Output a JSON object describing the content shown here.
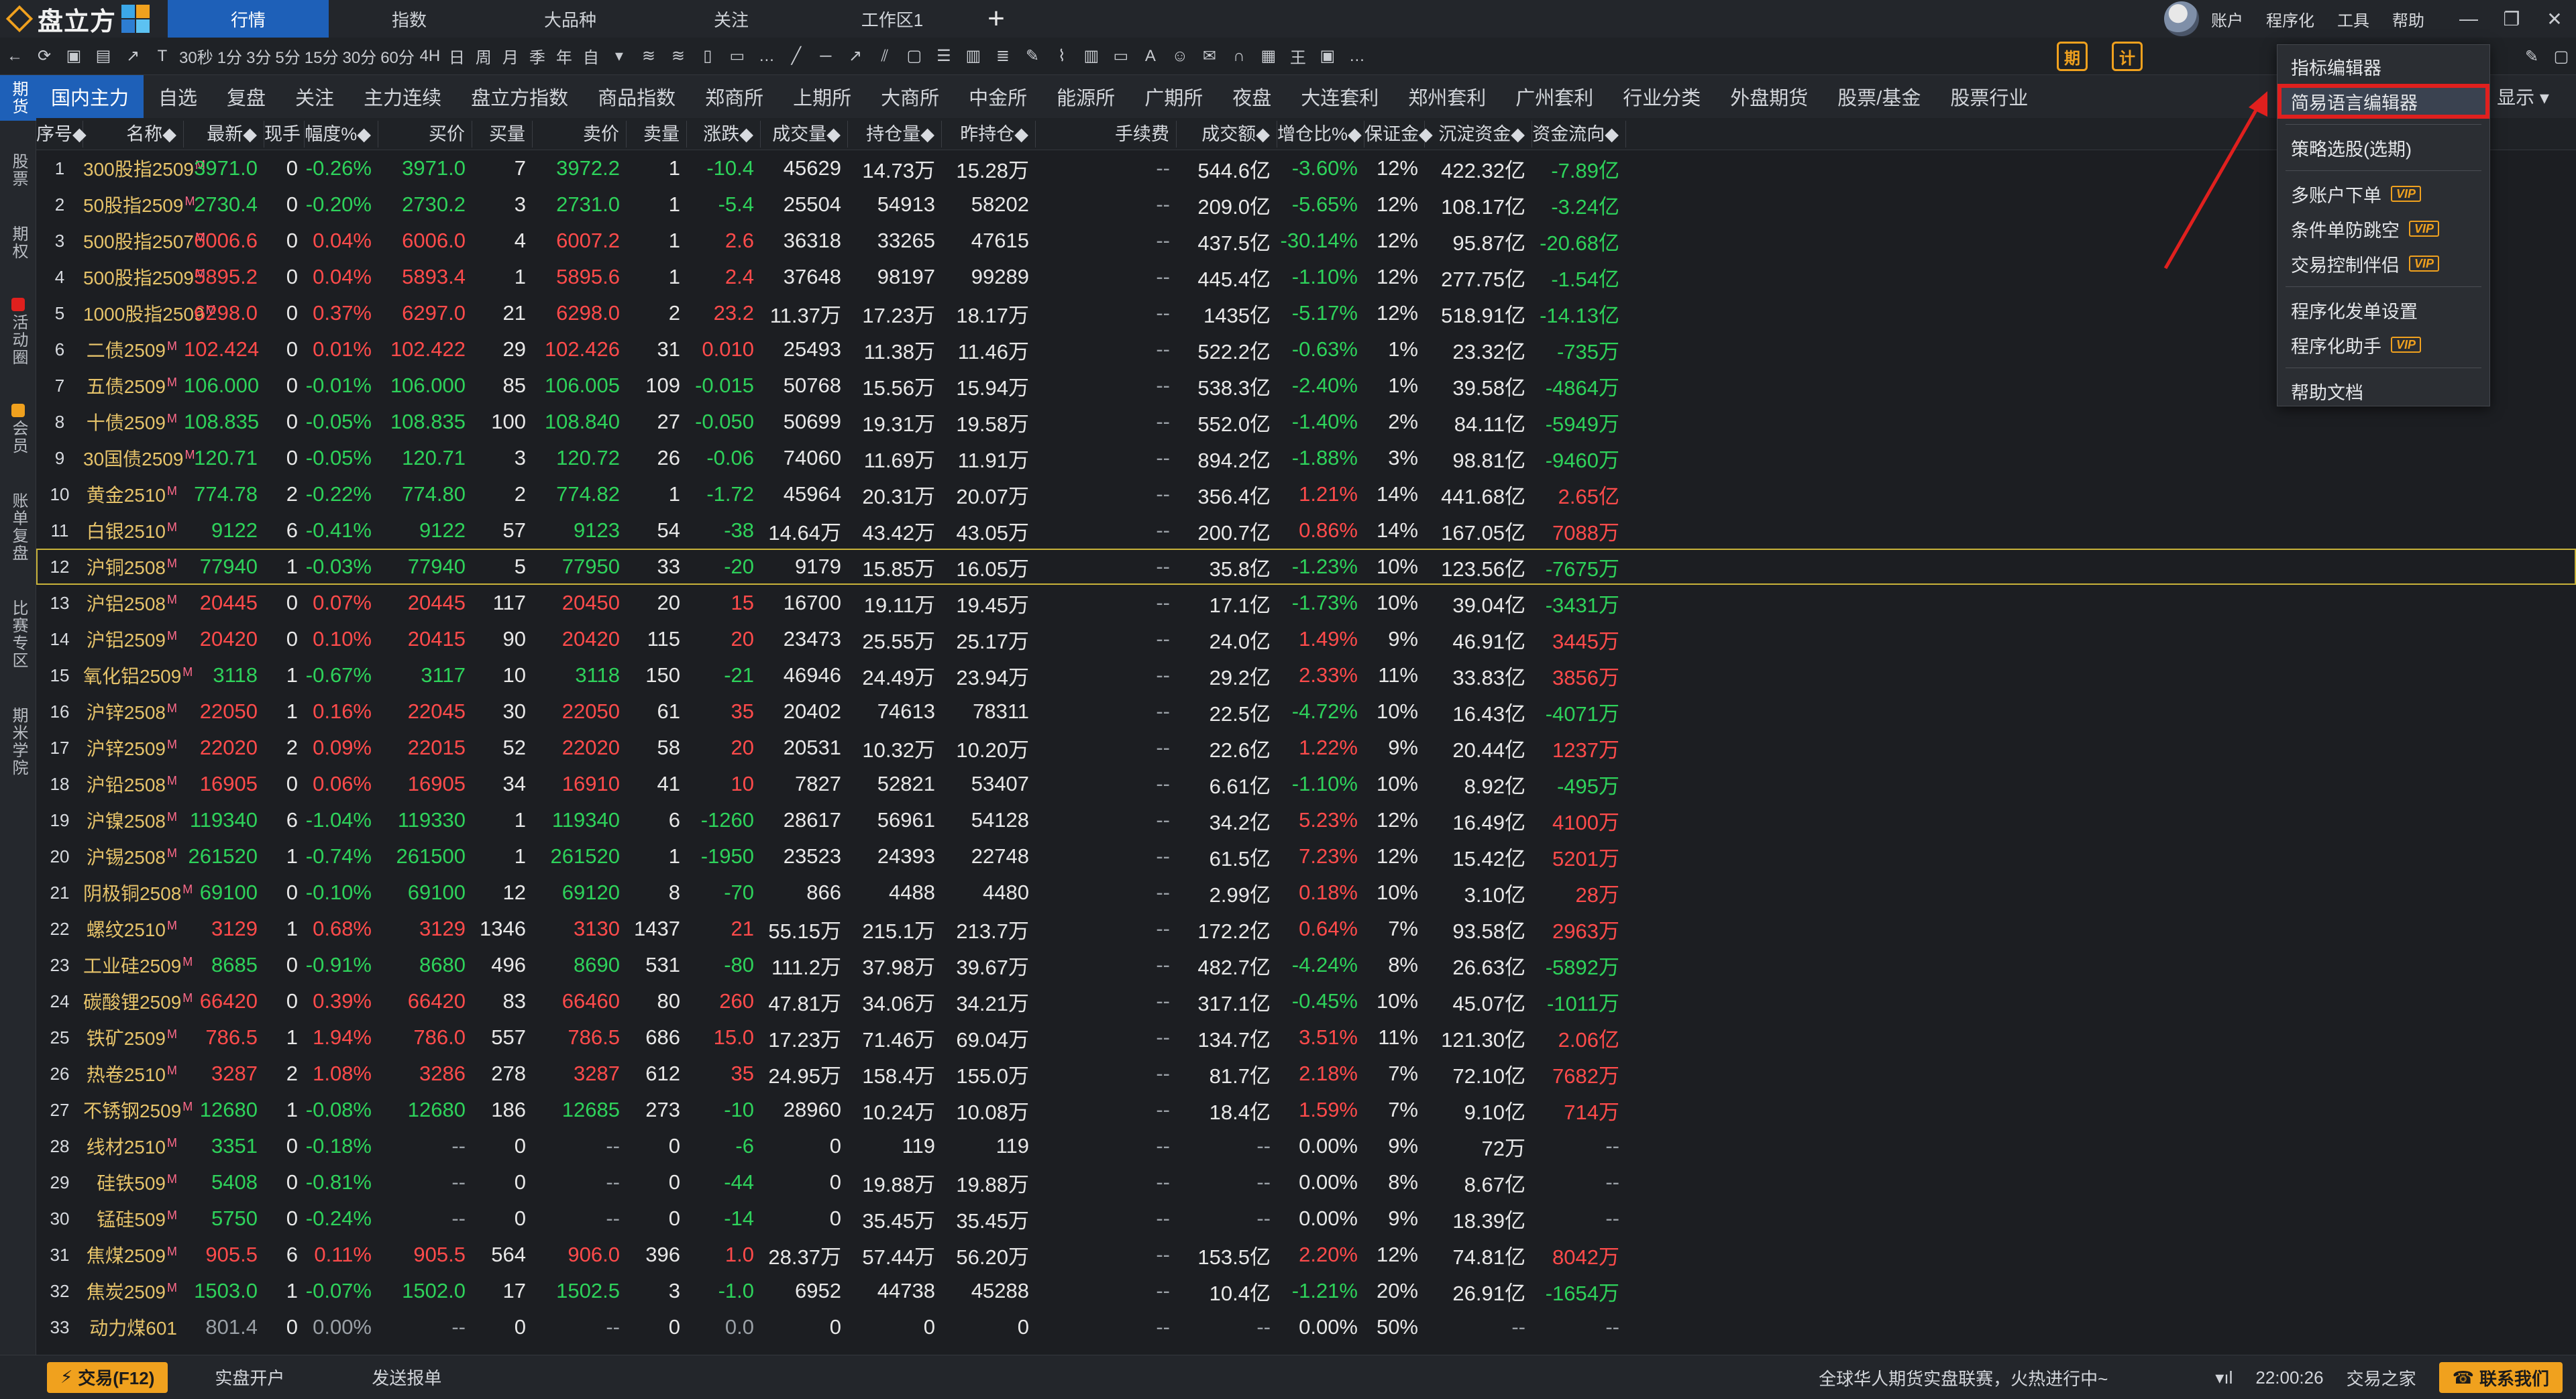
{
  "app": {
    "logo_text": "盘立方",
    "tabs": [
      {
        "label": "行情",
        "active": true
      },
      {
        "label": "指数",
        "active": false
      },
      {
        "label": "大品种",
        "active": false
      },
      {
        "label": "关注",
        "active": false
      },
      {
        "label": "工作区1",
        "active": false
      }
    ],
    "add_tab": "+",
    "top_menu": [
      "账户",
      "程序化",
      "工具",
      "帮助"
    ],
    "window_controls": [
      "—",
      "❐",
      "✕"
    ]
  },
  "toolbar": {
    "nav_icons": [
      "←",
      "⟳",
      "▣",
      "▤",
      "↗",
      "T"
    ],
    "periods": [
      "30秒",
      "1分",
      "3分",
      "5分",
      "15分",
      "30分",
      "60分",
      "4H",
      "日",
      "周",
      "月",
      "季",
      "年",
      "自"
    ],
    "draw_icons": [
      "▾",
      "≋",
      "≋",
      "▯",
      "▭",
      "…",
      "╱",
      "─",
      "↗",
      "⫽",
      "▢",
      "☰",
      "▥",
      "≣",
      "✎",
      "⌇",
      "▥",
      "▭",
      "A",
      "☺",
      "✉",
      "∩",
      "▦",
      "王",
      "▣",
      "…"
    ],
    "right_icons": [
      "期",
      "计"
    ],
    "far_right": [
      "✎",
      "▢"
    ]
  },
  "siderail": [
    {
      "label": "期货",
      "active": true
    },
    {
      "label": "股票",
      "active": false
    },
    {
      "label": "期权",
      "active": false
    },
    {
      "label": "活动圈",
      "active": false,
      "color": "#e0201e"
    },
    {
      "label": "会员",
      "active": false,
      "color": "#f0a11e"
    },
    {
      "label": "账单复盘",
      "active": false
    },
    {
      "label": "比赛专区",
      "active": false
    },
    {
      "label": "期米学院",
      "active": false
    }
  ],
  "categories": [
    {
      "label": "国内主力",
      "active": true
    },
    {
      "label": "自选"
    },
    {
      "label": "复盘"
    },
    {
      "label": "关注"
    },
    {
      "label": "主力连续"
    },
    {
      "label": "盘立方指数"
    },
    {
      "label": "商品指数"
    },
    {
      "label": "郑商所"
    },
    {
      "label": "上期所"
    },
    {
      "label": "大商所"
    },
    {
      "label": "中金所"
    },
    {
      "label": "能源所"
    },
    {
      "label": "广期所"
    },
    {
      "label": "夜盘"
    },
    {
      "label": "大连套利"
    },
    {
      "label": "郑州套利"
    },
    {
      "label": "广州套利"
    },
    {
      "label": "行业分类"
    },
    {
      "label": "外盘期货"
    },
    {
      "label": "股票/基金"
    },
    {
      "label": "股票行业"
    }
  ],
  "display_label": "显示 ▾",
  "table": {
    "headers": [
      "序号◆",
      "名称◆",
      "最新◆",
      "现手",
      "幅度%◆",
      "买价",
      "买量",
      "卖价",
      "卖量",
      "涨跌◆",
      "成交量◆",
      "持仓量◆",
      "昨持仓◆",
      "手续费",
      "成交额◆",
      "增仓比%◆",
      "保证金◆",
      "沉淀资金◆",
      "资金流向◆"
    ],
    "rows": [
      [
        "1",
        "300股指2509",
        "3971.0",
        "0",
        "-0.26%",
        "3971.0",
        "7",
        "3972.2",
        "1",
        "-10.4",
        "45629",
        "14.73万",
        "15.28万",
        "--",
        "544.6亿",
        "-3.60%",
        "12%",
        "422.32亿",
        "-7.89亿"
      ],
      [
        "2",
        "50股指2509",
        "2730.4",
        "0",
        "-0.20%",
        "2730.2",
        "3",
        "2731.0",
        "1",
        "-5.4",
        "25504",
        "54913",
        "58202",
        "--",
        "209.0亿",
        "-5.65%",
        "12%",
        "108.17亿",
        "-3.24亿"
      ],
      [
        "3",
        "500股指2507",
        "6006.6",
        "0",
        "0.04%",
        "6006.0",
        "4",
        "6007.2",
        "1",
        "2.6",
        "36318",
        "33265",
        "47615",
        "--",
        "437.5亿",
        "-30.14%",
        "12%",
        "95.87亿",
        "-20.68亿"
      ],
      [
        "4",
        "500股指2509",
        "5895.2",
        "0",
        "0.04%",
        "5893.4",
        "1",
        "5895.6",
        "1",
        "2.4",
        "37648",
        "98197",
        "99289",
        "--",
        "445.4亿",
        "-1.10%",
        "12%",
        "277.75亿",
        "-1.54亿"
      ],
      [
        "5",
        "1000股指2509",
        "6298.0",
        "0",
        "0.37%",
        "6297.0",
        "21",
        "6298.0",
        "2",
        "23.2",
        "11.37万",
        "17.23万",
        "18.17万",
        "--",
        "1435亿",
        "-5.17%",
        "12%",
        "518.91亿",
        "-14.13亿"
      ],
      [
        "6",
        "二债2509",
        "102.424",
        "0",
        "0.01%",
        "102.422",
        "29",
        "102.426",
        "31",
        "0.010",
        "25493",
        "11.38万",
        "11.46万",
        "--",
        "522.2亿",
        "-0.63%",
        "1%",
        "23.32亿",
        "-735万"
      ],
      [
        "7",
        "五债2509",
        "106.000",
        "0",
        "-0.01%",
        "106.000",
        "85",
        "106.005",
        "109",
        "-0.015",
        "50768",
        "15.56万",
        "15.94万",
        "--",
        "538.3亿",
        "-2.40%",
        "1%",
        "39.58亿",
        "-4864万"
      ],
      [
        "8",
        "十债2509",
        "108.835",
        "0",
        "-0.05%",
        "108.835",
        "100",
        "108.840",
        "27",
        "-0.050",
        "50699",
        "19.31万",
        "19.58万",
        "--",
        "552.0亿",
        "-1.40%",
        "2%",
        "84.11亿",
        "-5949万"
      ],
      [
        "9",
        "30国债2509",
        "120.71",
        "0",
        "-0.05%",
        "120.71",
        "3",
        "120.72",
        "26",
        "-0.06",
        "74060",
        "11.69万",
        "11.91万",
        "--",
        "894.2亿",
        "-1.88%",
        "3%",
        "98.81亿",
        "-9460万"
      ],
      [
        "10",
        "黄金2510",
        "774.78",
        "2",
        "-0.22%",
        "774.80",
        "2",
        "774.82",
        "1",
        "-1.72",
        "45964",
        "20.31万",
        "20.07万",
        "--",
        "356.4亿",
        "1.21%",
        "14%",
        "441.68亿",
        "2.65亿"
      ],
      [
        "11",
        "白银2510",
        "9122",
        "6",
        "-0.41%",
        "9122",
        "57",
        "9123",
        "54",
        "-38",
        "14.64万",
        "43.42万",
        "43.05万",
        "--",
        "200.7亿",
        "0.86%",
        "14%",
        "167.05亿",
        "7088万"
      ],
      [
        "12",
        "沪铜2508",
        "77940",
        "1",
        "-0.03%",
        "77940",
        "5",
        "77950",
        "33",
        "-20",
        "9179",
        "15.85万",
        "16.05万",
        "--",
        "35.8亿",
        "-1.23%",
        "10%",
        "123.56亿",
        "-7675万"
      ],
      [
        "13",
        "沪铝2508",
        "20445",
        "0",
        "0.07%",
        "20445",
        "117",
        "20450",
        "20",
        "15",
        "16700",
        "19.11万",
        "19.45万",
        "--",
        "17.1亿",
        "-1.73%",
        "10%",
        "39.04亿",
        "-3431万"
      ],
      [
        "14",
        "沪铝2509",
        "20420",
        "0",
        "0.10%",
        "20415",
        "90",
        "20420",
        "115",
        "20",
        "23473",
        "25.55万",
        "25.17万",
        "--",
        "24.0亿",
        "1.49%",
        "9%",
        "46.91亿",
        "3445万"
      ],
      [
        "15",
        "氧化铝2509",
        "3118",
        "1",
        "-0.67%",
        "3117",
        "10",
        "3118",
        "150",
        "-21",
        "46946",
        "24.49万",
        "23.94万",
        "--",
        "29.2亿",
        "2.33%",
        "11%",
        "33.83亿",
        "3856万"
      ],
      [
        "16",
        "沪锌2508",
        "22050",
        "1",
        "0.16%",
        "22045",
        "30",
        "22050",
        "61",
        "35",
        "20402",
        "74613",
        "78311",
        "--",
        "22.5亿",
        "-4.72%",
        "10%",
        "16.43亿",
        "-4071万"
      ],
      [
        "17",
        "沪锌2509",
        "22020",
        "2",
        "0.09%",
        "22015",
        "52",
        "22020",
        "58",
        "20",
        "20531",
        "10.32万",
        "10.20万",
        "--",
        "22.6亿",
        "1.22%",
        "9%",
        "20.44亿",
        "1237万"
      ],
      [
        "18",
        "沪铅2508",
        "16905",
        "0",
        "0.06%",
        "16905",
        "34",
        "16910",
        "41",
        "10",
        "7827",
        "52821",
        "53407",
        "--",
        "6.61亿",
        "-1.10%",
        "10%",
        "8.92亿",
        "-495万"
      ],
      [
        "19",
        "沪镍2508",
        "119340",
        "6",
        "-1.04%",
        "119330",
        "1",
        "119340",
        "6",
        "-1260",
        "28617",
        "56961",
        "54128",
        "--",
        "34.2亿",
        "5.23%",
        "12%",
        "16.49亿",
        "4100万"
      ],
      [
        "20",
        "沪锡2508",
        "261520",
        "1",
        "-0.74%",
        "261500",
        "1",
        "261520",
        "1",
        "-1950",
        "23523",
        "24393",
        "22748",
        "--",
        "61.5亿",
        "7.23%",
        "12%",
        "15.42亿",
        "5201万"
      ],
      [
        "21",
        "阴极铜2508",
        "69100",
        "0",
        "-0.10%",
        "69100",
        "12",
        "69120",
        "8",
        "-70",
        "866",
        "4488",
        "4480",
        "--",
        "2.99亿",
        "0.18%",
        "10%",
        "3.10亿",
        "28万"
      ],
      [
        "22",
        "螺纹2510",
        "3129",
        "1",
        "0.68%",
        "3129",
        "1346",
        "3130",
        "1437",
        "21",
        "55.15万",
        "215.1万",
        "213.7万",
        "--",
        "172.2亿",
        "0.64%",
        "7%",
        "93.58亿",
        "2963万"
      ],
      [
        "23",
        "工业硅2509",
        "8685",
        "0",
        "-0.91%",
        "8680",
        "496",
        "8690",
        "531",
        "-80",
        "111.2万",
        "37.98万",
        "39.67万",
        "--",
        "482.7亿",
        "-4.24%",
        "8%",
        "26.63亿",
        "-5892万"
      ],
      [
        "24",
        "碳酸锂2509",
        "66420",
        "0",
        "0.39%",
        "66420",
        "83",
        "66460",
        "80",
        "260",
        "47.81万",
        "34.06万",
        "34.21万",
        "--",
        "317.1亿",
        "-0.45%",
        "10%",
        "45.07亿",
        "-1011万"
      ],
      [
        "25",
        "铁矿2509",
        "786.5",
        "1",
        "1.94%",
        "786.0",
        "557",
        "786.5",
        "686",
        "15.0",
        "17.23万",
        "71.46万",
        "69.04万",
        "--",
        "134.7亿",
        "3.51%",
        "11%",
        "121.30亿",
        "2.06亿"
      ],
      [
        "26",
        "热卷2510",
        "3287",
        "2",
        "1.08%",
        "3286",
        "278",
        "3287",
        "612",
        "35",
        "24.95万",
        "158.4万",
        "155.0万",
        "--",
        "81.7亿",
        "2.18%",
        "7%",
        "72.10亿",
        "7682万"
      ],
      [
        "27",
        "不锈钢2509",
        "12680",
        "1",
        "-0.08%",
        "12680",
        "186",
        "12685",
        "273",
        "-10",
        "28960",
        "10.24万",
        "10.08万",
        "--",
        "18.4亿",
        "1.59%",
        "7%",
        "9.10亿",
        "714万"
      ],
      [
        "28",
        "线材2510",
        "3351",
        "0",
        "-0.18%",
        "--",
        "0",
        "--",
        "0",
        "-6",
        "0",
        "119",
        "119",
        "--",
        "--",
        "0.00%",
        "9%",
        "72万",
        "--"
      ],
      [
        "29",
        "硅铁509",
        "5408",
        "0",
        "-0.81%",
        "--",
        "0",
        "--",
        "0",
        "-44",
        "0",
        "19.88万",
        "19.88万",
        "--",
        "--",
        "0.00%",
        "8%",
        "8.67亿",
        "--"
      ],
      [
        "30",
        "锰硅509",
        "5750",
        "0",
        "-0.24%",
        "--",
        "0",
        "--",
        "0",
        "-14",
        "0",
        "35.45万",
        "35.45万",
        "--",
        "--",
        "0.00%",
        "9%",
        "18.39亿",
        "--"
      ],
      [
        "31",
        "焦煤2509",
        "905.5",
        "6",
        "0.11%",
        "905.5",
        "564",
        "906.0",
        "396",
        "1.0",
        "28.37万",
        "57.44万",
        "56.20万",
        "--",
        "153.5亿",
        "2.20%",
        "12%",
        "74.81亿",
        "8042万"
      ],
      [
        "32",
        "焦炭2509",
        "1503.0",
        "1",
        "-0.07%",
        "1502.0",
        "17",
        "1502.5",
        "3",
        "-1.0",
        "6952",
        "44738",
        "45288",
        "--",
        "10.4亿",
        "-1.21%",
        "20%",
        "26.91亿",
        "-1654万"
      ],
      [
        "33",
        "动力煤601",
        "801.4",
        "0",
        "0.00%",
        "--",
        "0",
        "--",
        "0",
        "0.0",
        "0",
        "0",
        "0",
        "--",
        "--",
        "0.00%",
        "50%",
        "--",
        "--"
      ]
    ],
    "superscript": "M"
  },
  "dropdown": {
    "items": [
      {
        "label": "指标编辑器"
      },
      {
        "label": "简易语言编辑器",
        "highlight": true
      },
      {
        "sep": true
      },
      {
        "label": "策略选股(选期)"
      },
      {
        "sep": true
      },
      {
        "label": "多账户下单",
        "vip": true
      },
      {
        "label": "条件单防跳空",
        "vip": true
      },
      {
        "label": "交易控制伴侣",
        "vip": true
      },
      {
        "sep": true
      },
      {
        "label": "程序化发单设置"
      },
      {
        "label": "程序化助手",
        "vip": true
      },
      {
        "sep": true
      },
      {
        "label": "帮助文档"
      }
    ],
    "vip_label": "VIP"
  },
  "statusbar": {
    "trade_button": "交易(F12)",
    "open_account": "实盘开户",
    "send_report": "发送报单",
    "news": "全球华人期货实盘联赛，火热进行中~",
    "signal": "▾ıl",
    "time": "22:00:26",
    "trade_home": "交易之家",
    "contact": "联系我们"
  },
  "colors": {
    "accent": "#1e60b8",
    "up": "#ff4b4b",
    "down": "#2ed25b",
    "orange": "#f0a11e",
    "highlight_border": "#e0201e"
  }
}
